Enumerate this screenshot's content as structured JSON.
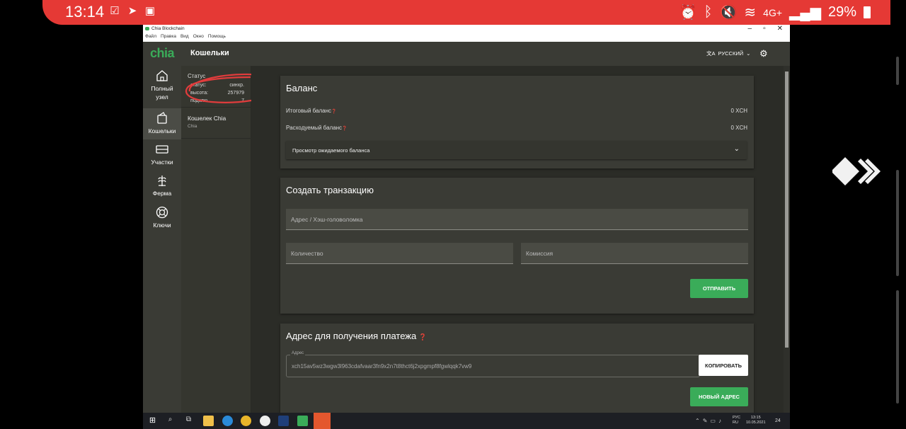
{
  "phone": {
    "time": "13:14",
    "battery": "29%",
    "network": "4G+"
  },
  "window": {
    "title": "Chia Blockchain",
    "menu": [
      "Файл",
      "Правка",
      "Вид",
      "Окно",
      "Помощь"
    ],
    "controls": {
      "minimize": "–",
      "maximize": "▫",
      "close": "✕"
    }
  },
  "app": {
    "logo": "chia",
    "title": "Кошельки",
    "language": "РУССКИЙ"
  },
  "sidebar": {
    "items": [
      {
        "label_line1": "Полный",
        "label_line2": "узел",
        "icon": "home-icon"
      },
      {
        "label_line1": "Кошельки",
        "label_line2": "",
        "icon": "wallet-icon"
      },
      {
        "label_line1": "Участки",
        "label_line2": "",
        "icon": "storage-icon"
      },
      {
        "label_line1": "Ферма",
        "label_line2": "",
        "icon": "farm-icon"
      },
      {
        "label_line1": "Ключи",
        "label_line2": "",
        "icon": "lifebuoy-icon"
      }
    ]
  },
  "status": {
    "title": "Статус",
    "rows": [
      {
        "label": "статус:",
        "value": "синхр."
      },
      {
        "label": "высота:",
        "value": "257979"
      },
      {
        "label": "подклю",
        "value": "7"
      }
    ]
  },
  "wallet_list": {
    "name": "Кошелек Chia",
    "sub": "Chia"
  },
  "balance": {
    "title": "Баланс",
    "total_label": "Итоговый баланс",
    "total_value": "0 XCH",
    "spendable_label": "Расходуемый баланс",
    "spendable_value": "0 XCH",
    "pending_label": "Просмотр ожидаемого баланса"
  },
  "transaction": {
    "title": "Создать транзакцию",
    "address_placeholder": "Адрес / Хэш-головоломка",
    "amount_placeholder": "Количество",
    "fee_placeholder": "Комиссия",
    "send_label": "ОТПРАВИТЬ"
  },
  "receive": {
    "title": "Адрес для получения платежа",
    "address_label": "Адрес",
    "address_value": "xch15av5wz3wgw3l963cdafvaar3fn9x2n7t8thct6j2xpgmpf8fgwlqqk7vw9",
    "copy_label": "КОПИРОВАТЬ",
    "new_label": "НОВЫЙ АДРЕС"
  },
  "taskbar": {
    "lang_line1": "РУС",
    "lang_line2": "RU",
    "time": "13:15",
    "date": "10.05.2021",
    "notif": "24"
  },
  "colors": {
    "accent": "#3aac59",
    "phone_bar": "#e53935",
    "annotation": "#e03c3c"
  }
}
